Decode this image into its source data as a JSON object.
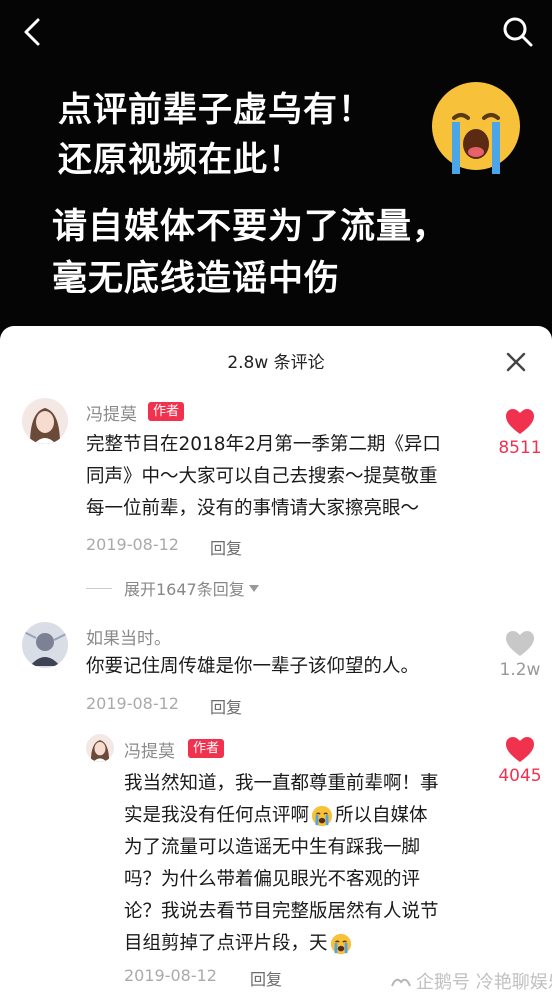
{
  "nav": {
    "back_icon": "chevron-left-icon",
    "search_icon": "search-icon"
  },
  "video": {
    "line1": "点评前辈子虚乌有！",
    "line2": "还原视频在此！",
    "line3": "请自媒体不要为了流量，",
    "line4": "毫无底线造谣中伤",
    "emoji": "loudly-crying-face-icon"
  },
  "panel": {
    "title": "2.8w 条评论",
    "close_icon": "close-icon"
  },
  "comments": [
    {
      "username": "冯提莫",
      "tag": "作者",
      "lines": [
        "完整节目在2018年2月第一季第二期《异口",
        "同声》中～大家可以自己去搜索～提莫敬重",
        "每一位前辈，没有的事情请大家擦亮眼～"
      ],
      "date": "2019-08-12",
      "reply_label": "回复",
      "like_count": "8511",
      "liked": true,
      "expand_label": "展开1647条回复"
    },
    {
      "username": "如果当时。",
      "lines": [
        "你要记住周传雄是你一辈子该仰望的人。"
      ],
      "date": "2019-08-12",
      "reply_label": "回复",
      "like_count": "1.2w",
      "liked": false
    },
    {
      "username": "冯提莫",
      "tag": "作者",
      "lines": [
        "我当然知道，我一直都尊重前辈啊！事",
        "实是我没有任何点评啊",
        "所以自媒体",
        "为了流量可以造谣无中生有踩我一脚",
        "吗？为什么带着偏见眼光不客观的评",
        "论？我说去看节目完整版居然有人说节",
        "目组剪掉了点评片段，天"
      ],
      "date": "2019-08-12",
      "reply_label": "回复",
      "like_count": "4045",
      "liked": true
    }
  ],
  "watermark": {
    "text": "企鹅号 冷艳聊娱乐"
  },
  "colors": {
    "like_red": "#f0324f",
    "like_gray": "#c8c8c8",
    "author_tag": "#f0324f"
  }
}
